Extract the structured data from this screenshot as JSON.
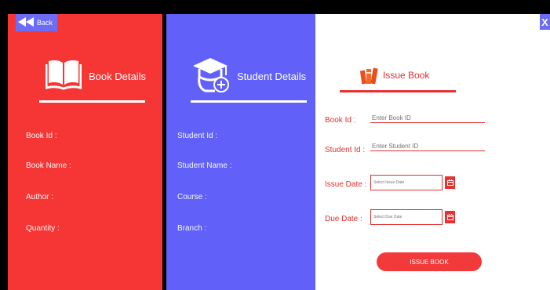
{
  "window": {
    "close_glyph": "X"
  },
  "back_button": {
    "label": "Back",
    "icon": "double-left-arrow-icon"
  },
  "book_panel": {
    "heading": "Book Details",
    "icon": "open-book-icon",
    "bg_color": "#f63535",
    "fields": [
      {
        "label": "Book Id :"
      },
      {
        "label": "Book Name :"
      },
      {
        "label": "Author :"
      },
      {
        "label": "Quantity :"
      }
    ]
  },
  "student_panel": {
    "heading": "Student Details",
    "icon": "graduate-add-icon",
    "bg_color": "#6161f9",
    "fields": [
      {
        "label": "Student Id :"
      },
      {
        "label": "Student Name :"
      },
      {
        "label": "Course :"
      },
      {
        "label": "Branch :"
      }
    ]
  },
  "issue_panel": {
    "heading": "Issue Book",
    "icon": "books-icon",
    "accent_color": "#e53333",
    "book_id": {
      "label": "Book Id :",
      "placeholder": "Enter Book ID",
      "value": ""
    },
    "student_id": {
      "label": "Student Id :",
      "placeholder": "Enter Student ID",
      "value": ""
    },
    "issue_date": {
      "label": "Issue Date :",
      "placeholder": "Select Issue Date",
      "value": ""
    },
    "due_date": {
      "label": "Due Date :",
      "placeholder": "Select Due Date",
      "value": ""
    },
    "submit_label": "ISSUE BOOK"
  }
}
